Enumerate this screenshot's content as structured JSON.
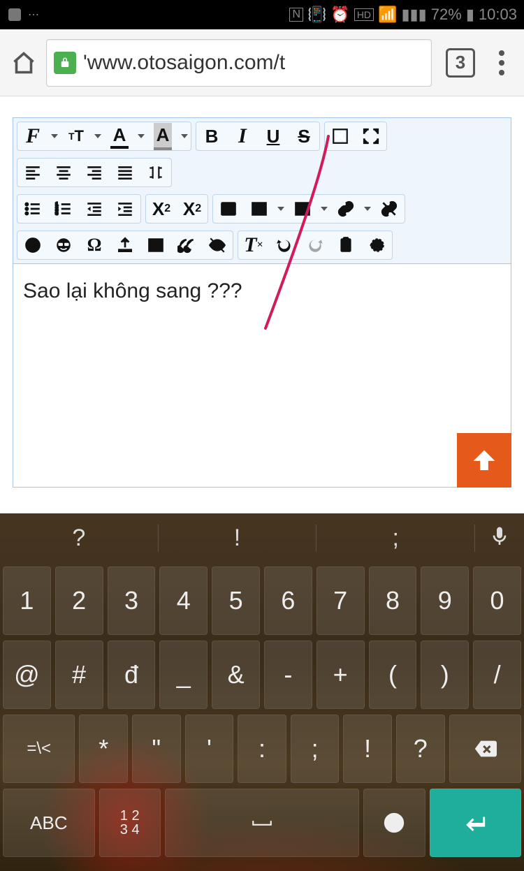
{
  "status": {
    "battery": "72%",
    "time": "10:03"
  },
  "browser": {
    "url_display": "'www.otosaigon.com/t",
    "tabs_count": "3"
  },
  "editor": {
    "content": "Sao lại không sang ???"
  },
  "keyboard": {
    "suggestions": [
      "?",
      "!",
      ";"
    ],
    "rows": [
      [
        "1",
        "2",
        "3",
        "4",
        "5",
        "6",
        "7",
        "8",
        "9",
        "0"
      ],
      [
        "@",
        "#",
        "đ",
        "_",
        "&",
        "-",
        "+",
        "(",
        ")",
        "/"
      ],
      [
        "=\\<",
        "*",
        "\"",
        "'",
        ":",
        ";",
        "!",
        "?"
      ]
    ],
    "abc": "ABC",
    "numsym": "12\n34"
  }
}
